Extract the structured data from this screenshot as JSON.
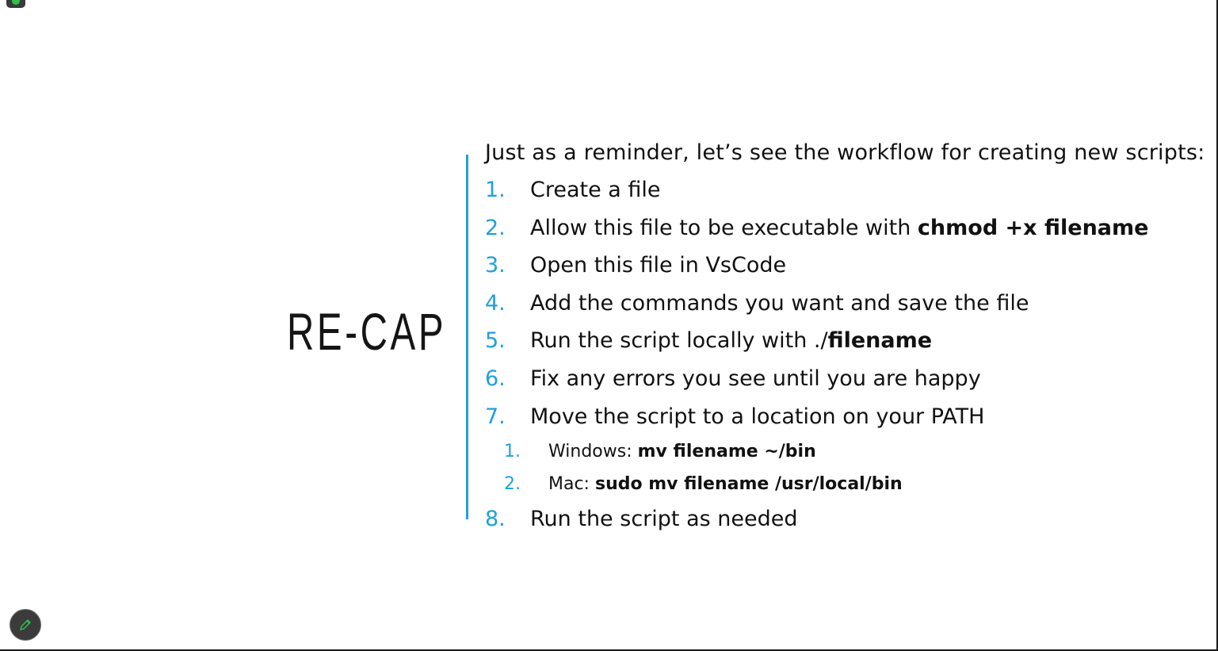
{
  "slide": {
    "title": "RE-CAP",
    "intro": "Just as a reminder, let’s see the workflow for creating new scripts:",
    "steps": [
      {
        "num": "1.",
        "text": "Create a file",
        "bold": ""
      },
      {
        "num": "2.",
        "text": "Allow this file to be executable with ",
        "bold": "chmod +x filename"
      },
      {
        "num": "3.",
        "text": "Open this file in VsCode",
        "bold": ""
      },
      {
        "num": "4.",
        "text": "Add the commands you want and save the file",
        "bold": ""
      },
      {
        "num": "5.",
        "text": "Run the script locally with ./",
        "bold": "filename"
      },
      {
        "num": "6.",
        "text": "Fix any errors you see until you are happy",
        "bold": ""
      },
      {
        "num": "7.",
        "text": "Move the script to a location on your PATH",
        "bold": ""
      },
      {
        "num": "8.",
        "text": "Run the script as needed",
        "bold": ""
      }
    ],
    "substeps": [
      {
        "num": "1.",
        "text": "Windows: ",
        "bold": "mv filename ~/bin",
        "tail": ""
      },
      {
        "num": "2.",
        "text": "Mac: ",
        "bold": "sudo mv filename ",
        "tail": "/usr/local/bin"
      }
    ]
  },
  "colors": {
    "accent": "#1fa1d8",
    "text": "#111111",
    "background": "#ffffff",
    "pen_icon": "#2ec24a"
  },
  "icons": {
    "status_chip": "shield-check-icon",
    "pen_button": "pen-icon"
  }
}
